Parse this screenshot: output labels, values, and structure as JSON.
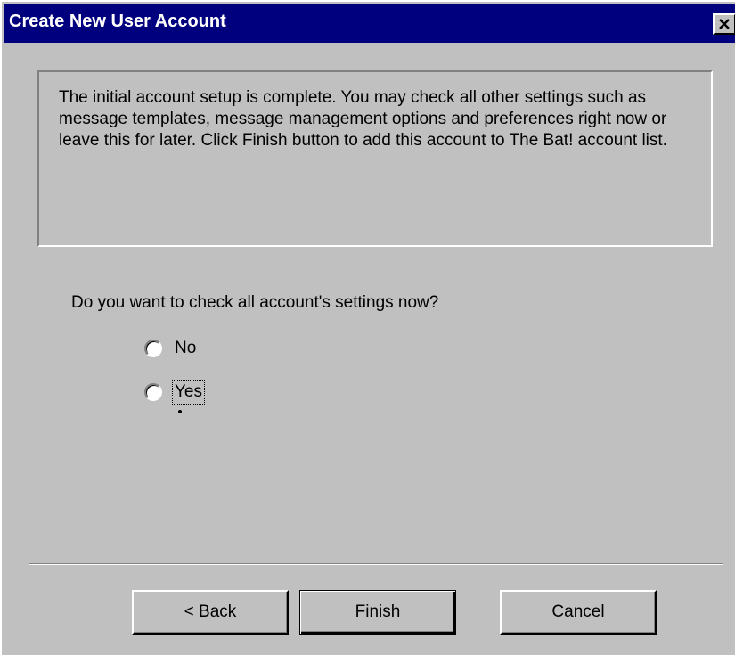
{
  "window": {
    "title": "Create New User Account",
    "close_glyph": "✕"
  },
  "info": {
    "text": "The initial account setup is complete. You may check all other settings such as message templates, message management options and preferences right now or leave this for later. Click Finish button to add this account to The Bat! account list."
  },
  "question": {
    "text": "Do you want to check all account's settings now?"
  },
  "options": [
    {
      "label": "No",
      "selected": false
    },
    {
      "label": "Yes",
      "selected": false,
      "focused": true
    }
  ],
  "buttons": {
    "back_prefix": "< ",
    "back_mnemonic": "B",
    "back_rest": "ack",
    "finish_mnemonic": "F",
    "finish_rest": "inish",
    "cancel": "Cancel"
  },
  "colors": {
    "titlebar": "#00007f",
    "face": "#c0c0c0"
  },
  "icons": {
    "close": "close-icon"
  }
}
